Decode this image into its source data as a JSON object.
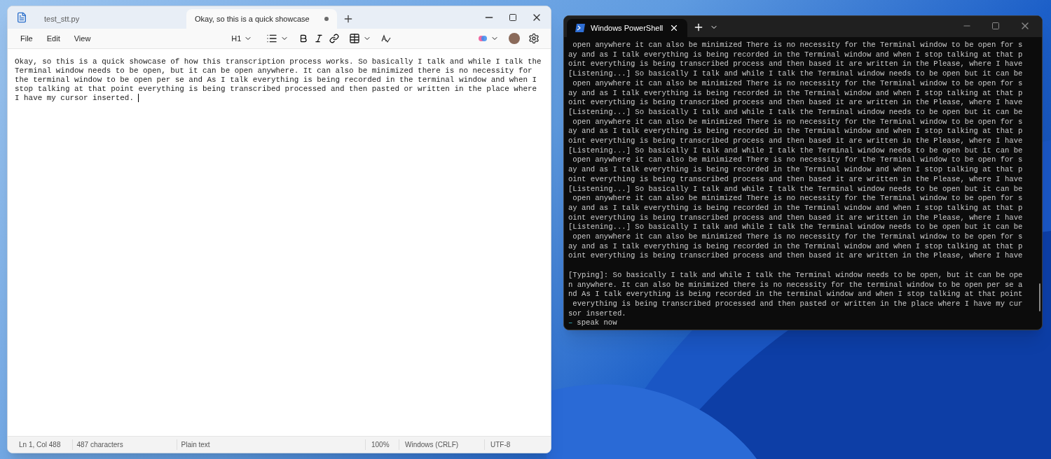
{
  "notepad": {
    "tabs": [
      {
        "label": "test_stt.py",
        "selected": false,
        "modified": false
      },
      {
        "label": "Okay, so this is a quick showcase",
        "selected": true,
        "modified": true
      }
    ],
    "menu": [
      "File",
      "Edit",
      "View"
    ],
    "toolbar": {
      "heading": "H1"
    },
    "text": "Okay, so this is a quick showcase of how this transcription process works. So basically I talk and while I talk the Terminal window needs to be open, but it can be open anywhere. It can also be minimized there is no necessity for the terminal window to be open per se and As I talk everything is being recorded in the terminal window and when I stop talking at that point everything is being transcribed processed and then pasted or written in the place where I have my cursor inserted. ",
    "status_bar": {
      "position": "Ln 1, Col 488",
      "characters": "487 characters",
      "format": "Plain text",
      "zoom": "100%",
      "line_endings": "Windows (CRLF)",
      "encoding": "UTF-8"
    }
  },
  "terminal": {
    "tab": {
      "label": "Windows PowerShell",
      "selected": true
    },
    "lines": [
      " open anywhere it can also be minimized There is no necessity for the Terminal window to be open for s",
      "ay and as I talk everything is being recorded in the Terminal window and when I stop talking at that p",
      "oint everything is being transcribed process and then based it are written in the Please, where I have",
      "[Listening...] So basically I talk and while I talk the Terminal window needs to be open but it can be",
      " open anywhere it can also be minimized There is no necessity for the Terminal window to be open for s",
      "ay and as I talk everything is being recorded in the Terminal window and when I stop talking at that p",
      "oint everything is being transcribed process and then based it are written in the Please, where I have",
      "[Listening...] So basically I talk and while I talk the Terminal window needs to be open but it can be",
      " open anywhere it can also be minimized There is no necessity for the Terminal window to be open for s",
      "ay and as I talk everything is being recorded in the Terminal window and when I stop talking at that p",
      "oint everything is being transcribed process and then based it are written in the Please, where I have",
      "[Listening...] So basically I talk and while I talk the Terminal window needs to be open but it can be",
      " open anywhere it can also be minimized There is no necessity for the Terminal window to be open for s",
      "ay and as I talk everything is being recorded in the Terminal window and when I stop talking at that p",
      "oint everything is being transcribed process and then based it are written in the Please, where I have",
      "[Listening...] So basically I talk and while I talk the Terminal window needs to be open but it can be",
      " open anywhere it can also be minimized There is no necessity for the Terminal window to be open for s",
      "ay and as I talk everything is being recorded in the Terminal window and when I stop talking at that p",
      "oint everything is being transcribed process and then based it are written in the Please, where I have",
      "[Listening...] So basically I talk and while I talk the Terminal window needs to be open but it can be",
      " open anywhere it can also be minimized There is no necessity for the Terminal window to be open for s",
      "ay and as I talk everything is being recorded in the Terminal window and when I stop talking at that p",
      "oint everything is being transcribed process and then based it are written in the Please, where I have"
    ],
    "typed_lines": [
      "[Typing]: So basically I talk and while I talk the Terminal window needs to be open, but it can be ope",
      "n anywhere. It can also be minimized there is no necessity for the terminal window to be open per se a",
      "nd As I talk everything is being recorded in the terminal window and when I stop talking at that point",
      " everything is being transcribed processed and then pasted or written in the place where I have my cur",
      "sor inserted."
    ],
    "prompt": {
      "marker": "–",
      "text": "speak now"
    }
  }
}
